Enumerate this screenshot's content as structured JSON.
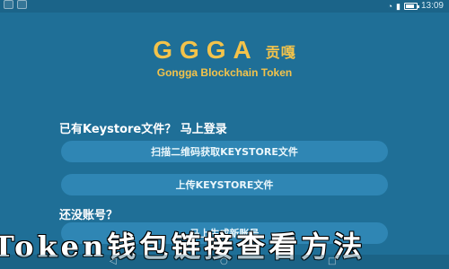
{
  "status_bar": {
    "time": "13:09",
    "icons": [
      "wifi-icon",
      "signal-icon",
      "battery-icon"
    ]
  },
  "branding": {
    "logo_letters": "GGGA",
    "logo_cn": "贡嘎",
    "subtitle": "Gongga Blockchain Token"
  },
  "keystore_section": {
    "label": "已有Keystore文件？",
    "login_link": "马上登录",
    "scan_button": "扫描二维码获取KEYSTORE文件",
    "upload_button": "上传KEYSTORE文件"
  },
  "register_section": {
    "label": "还没账号？",
    "create_button": "马上生成新账号"
  },
  "overlay": {
    "text": "Token钱包链接查看方法"
  },
  "colors": {
    "background": "#1f6f97",
    "button": "#2f86b4",
    "brand_gold": "#f3c34b"
  },
  "nav_bar": {
    "icons": [
      "back-icon",
      "home-icon",
      "recent-apps-icon"
    ]
  }
}
